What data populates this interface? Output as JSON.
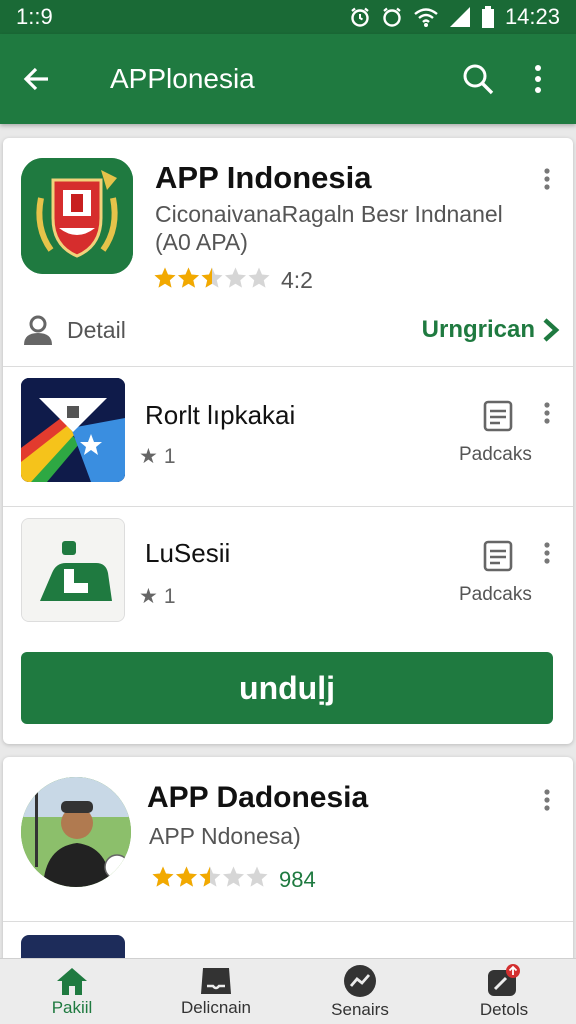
{
  "status_bar": {
    "left_time": "1::9",
    "right_time": "14:23"
  },
  "app_bar": {
    "title": "APPlonesia",
    "back_icon": "arrow-back-icon",
    "search_icon": "search-icon",
    "menu_icon": "more-vert-icon"
  },
  "featured": {
    "title": "APP Indonesia",
    "subtitle_line1": "CiconaivanaRagaln Besr Indnanel",
    "subtitle_line2": "(A0 APA)",
    "rating": 2.5,
    "rating_text": "4:2",
    "detail_label": "Detail",
    "action_link": "Urngrican"
  },
  "list_items": [
    {
      "title": "Rorlt lıpkakai",
      "rating_text": "1",
      "package_label": "Padcaks"
    },
    {
      "title": "LuSesii",
      "rating_text": "1",
      "package_label": "Padcaks"
    }
  ],
  "download_button": "unduḷj",
  "second_card": {
    "title": "APP Dadonesia",
    "subtitle": "APP Ndonesa)",
    "rating": 2.5,
    "rating_text": "984"
  },
  "bottom_nav": [
    {
      "label": "Pakiil",
      "icon": "home-icon",
      "active": true
    },
    {
      "label": "Delicnain",
      "icon": "inbox-icon",
      "active": false
    },
    {
      "label": "Senairs",
      "icon": "trending-icon",
      "active": false
    },
    {
      "label": "Detols",
      "icon": "updates-icon",
      "active": false
    }
  ],
  "colors": {
    "primary": "#1f7a40",
    "status_bar": "#1a6a36",
    "star": "#f2a900",
    "star_empty": "#d6d6d6"
  }
}
